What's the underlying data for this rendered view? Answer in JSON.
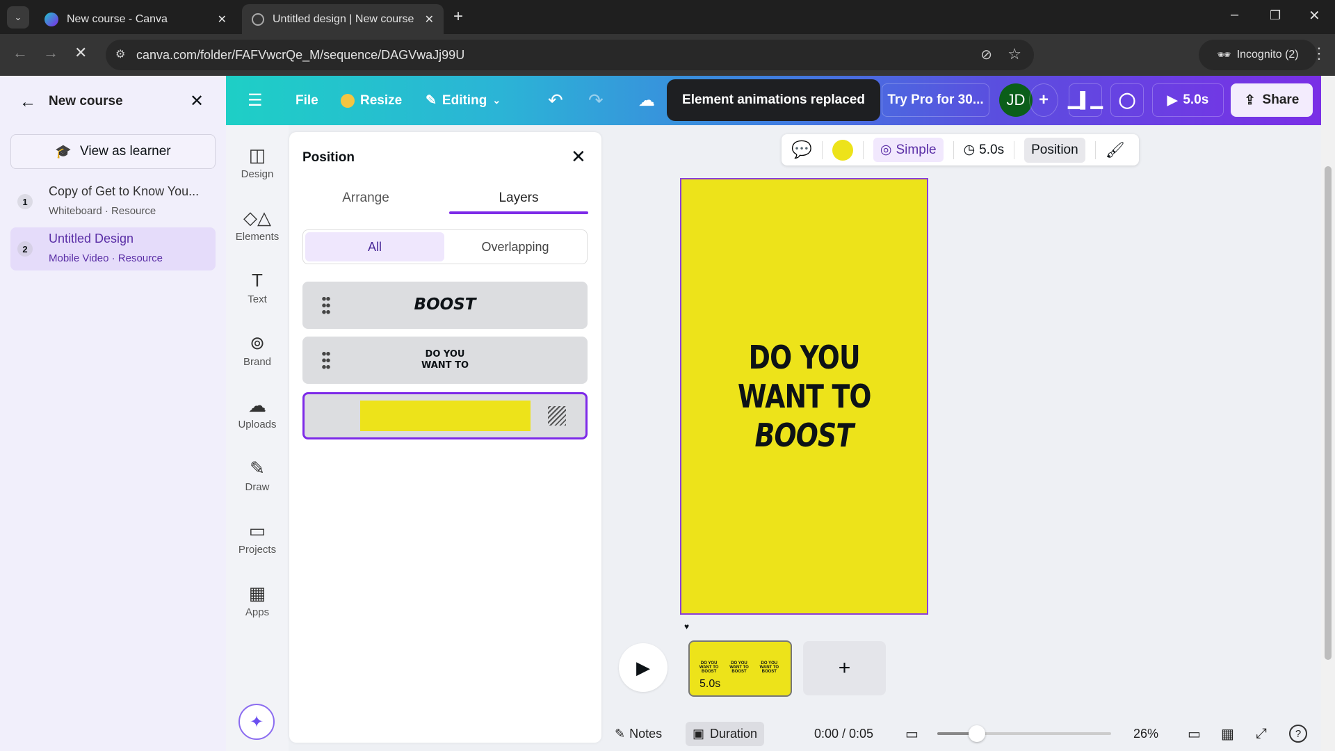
{
  "browser": {
    "tabs": [
      {
        "title": "New course - Canva",
        "active": false
      },
      {
        "title": "Untitled design | New course",
        "active": true
      }
    ],
    "url": "canva.com/folder/FAFVwcrQe_M/sequence/DAGVwaJj99U",
    "incognito": "Incognito (2)"
  },
  "header": {
    "file": "File",
    "resize": "Resize",
    "editing": "Editing",
    "try_pro": "Try Pro for 30...",
    "avatar": "JD",
    "play_duration": "5.0s",
    "share": "Share"
  },
  "toast": "Element animations replaced",
  "course": {
    "title": "New course",
    "view_as_learner": "View as learner",
    "items": [
      {
        "num": "1",
        "title": "Copy of Get to Know You...",
        "subtitle": "Whiteboard · Resource",
        "selected": false
      },
      {
        "num": "2",
        "title": "Untitled Design",
        "subtitle": "Mobile Video · Resource",
        "selected": true
      }
    ]
  },
  "rail": [
    {
      "label": "Design"
    },
    {
      "label": "Elements"
    },
    {
      "label": "Text"
    },
    {
      "label": "Brand"
    },
    {
      "label": "Uploads"
    },
    {
      "label": "Draw"
    },
    {
      "label": "Projects"
    },
    {
      "label": "Apps"
    }
  ],
  "position_panel": {
    "title": "Position",
    "tabs": [
      "Arrange",
      "Layers"
    ],
    "active_tab": "Layers",
    "filters": [
      "All",
      "Overlapping"
    ],
    "active_filter": "All",
    "layers": [
      {
        "text": "BOOST"
      },
      {
        "text_line1": "DO YOU",
        "text_line2": "WANT TO"
      },
      {
        "type": "background",
        "color": "#ede31a",
        "selected": true
      }
    ]
  },
  "float_toolbar": {
    "color": "#ede31a",
    "animation": "Simple",
    "duration": "5.0s",
    "position": "Position"
  },
  "canvas": {
    "line1": "DO YOU",
    "line2": "WANT TO",
    "line3": "BOOST",
    "bg": "#ede31a"
  },
  "timeline": {
    "page_duration": "5.0s",
    "thumb_text": "DO YOU WANT TO BOOST"
  },
  "bottom": {
    "notes": "Notes",
    "duration": "Duration",
    "time": "0:00 / 0:05",
    "zoom": "26%",
    "zoom_level": 26
  },
  "colors": {
    "accent": "#7d2ae8",
    "teal": "#1ecfc6"
  }
}
